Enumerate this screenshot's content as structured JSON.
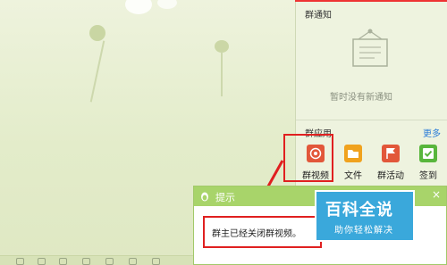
{
  "notice": {
    "title": "群通知",
    "empty_text": "暂时没有新通知"
  },
  "apps": {
    "title": "群应用",
    "more_label": "更多",
    "items": [
      {
        "label": "群视频",
        "icon": "group-video-icon",
        "color": "#e2573a"
      },
      {
        "label": "文件",
        "icon": "folder-icon",
        "color": "#f0a21e"
      },
      {
        "label": "群活动",
        "icon": "flag-icon",
        "color": "#e2573a"
      },
      {
        "label": "签到",
        "icon": "checkbox-icon",
        "color": "#58b63c"
      }
    ]
  },
  "popup": {
    "title": "提示",
    "message": "群主已经关闭群视频。",
    "close_label": "×"
  },
  "watermark": {
    "big": "百科全说",
    "small": "助你轻松解决"
  },
  "colors": {
    "annotation_red": "#e02020",
    "popup_header": "#a8d46a",
    "link_blue": "#2a7cd8",
    "watermark_blue": "#3aa8db"
  }
}
